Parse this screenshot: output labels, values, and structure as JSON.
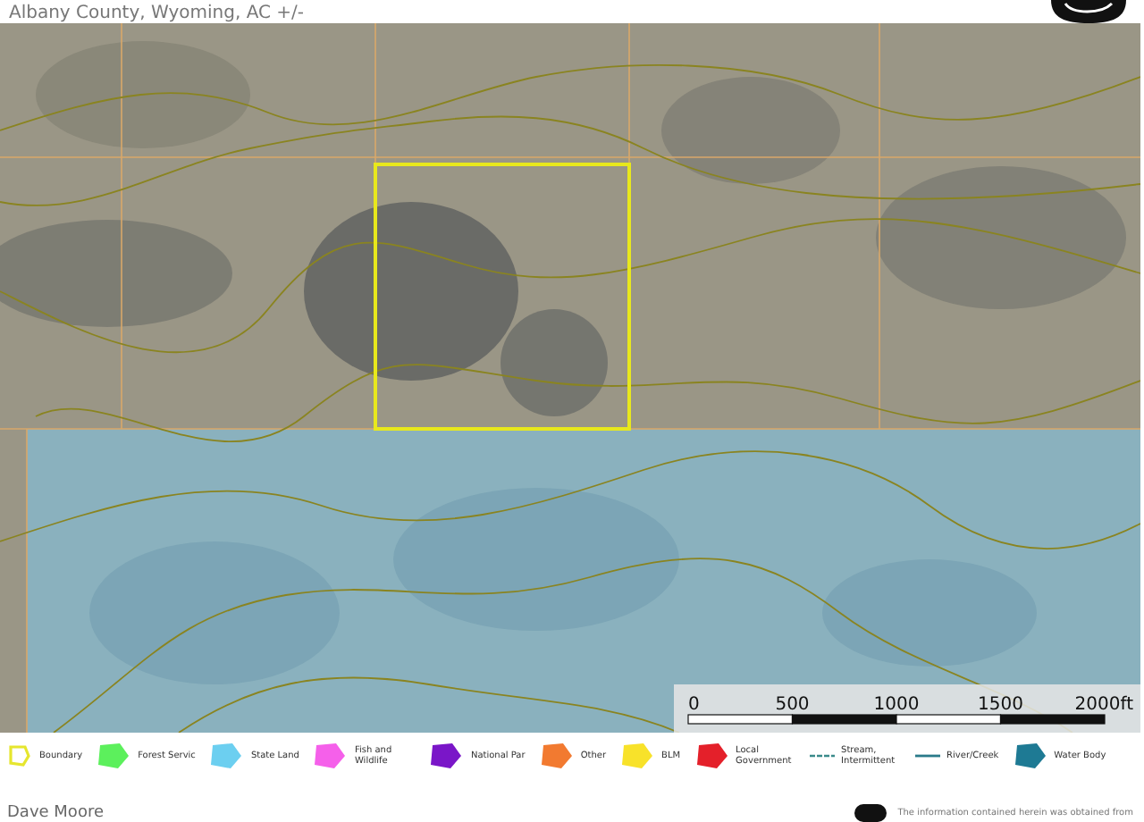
{
  "header": {
    "title": "Albany County, Wyoming,  AC +/-"
  },
  "map": {
    "scale_bar": {
      "labels": [
        "0",
        "500",
        "1000",
        "1500",
        "2000ft"
      ]
    }
  },
  "legend": {
    "items": [
      {
        "kind": "outline",
        "label": "Boundary",
        "color": "#e6e62e"
      },
      {
        "kind": "area",
        "label": "Forest Servic",
        "color": "#5cf05c"
      },
      {
        "kind": "area",
        "label": "State Land",
        "color": "#6ccff0"
      },
      {
        "kind": "area",
        "label": "Fish and Wildlife",
        "color": "#f560ea"
      },
      {
        "kind": "area",
        "label": "National Par",
        "color": "#7a16c8"
      },
      {
        "kind": "area",
        "label": "Other",
        "color": "#f27a30"
      },
      {
        "kind": "area",
        "label": "BLM",
        "color": "#f8e22a"
      },
      {
        "kind": "area",
        "label": "Local Government",
        "color": "#e4202a"
      },
      {
        "kind": "dashed-line",
        "label": "Stream, Intermittent",
        "color": "#3a8a8a"
      },
      {
        "kind": "line",
        "label": "River/Creek",
        "color": "#2a7a8a"
      },
      {
        "kind": "area",
        "label": "Water Body",
        "color": "#1e7a94"
      }
    ]
  },
  "footer": {
    "agent": "Dave Moore",
    "disclaimer": "The information contained herein was obtained from"
  }
}
